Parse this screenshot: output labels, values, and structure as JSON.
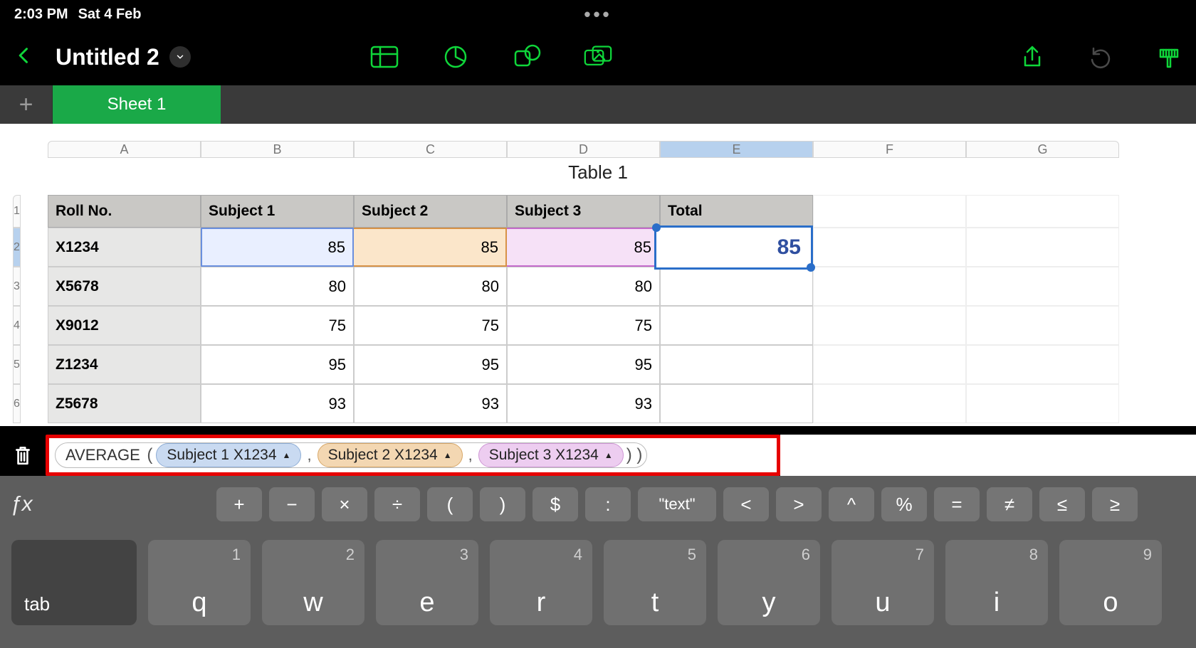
{
  "status": {
    "time": "2:03 PM",
    "date": "Sat 4 Feb"
  },
  "titlebar": {
    "doc_title": "Untitled 2"
  },
  "tabs": {
    "sheet": "Sheet 1"
  },
  "sheet": {
    "table_title": "Table 1",
    "columns": [
      "A",
      "B",
      "C",
      "D",
      "E",
      "F",
      "G"
    ],
    "selected_col": "E",
    "row_numbers": [
      "1",
      "2",
      "3",
      "4",
      "5",
      "6"
    ],
    "selected_row": "2",
    "headers": [
      "Roll No.",
      "Subject 1",
      "Subject 2",
      "Subject 3",
      "Total"
    ],
    "rows": [
      {
        "roll": "X1234",
        "s1": "85",
        "s2": "85",
        "s3": "85",
        "total": "85"
      },
      {
        "roll": "X5678",
        "s1": "80",
        "s2": "80",
        "s3": "80",
        "total": ""
      },
      {
        "roll": "X9012",
        "s1": "75",
        "s2": "75",
        "s3": "75",
        "total": ""
      },
      {
        "roll": "Z1234",
        "s1": "95",
        "s2": "95",
        "s3": "95",
        "total": ""
      },
      {
        "roll": "Z5678",
        "s1": "93",
        "s2": "93",
        "s3": "93",
        "total": ""
      }
    ],
    "active_value": "85"
  },
  "formula": {
    "function": "AVERAGE",
    "args": [
      {
        "label": "Subject 1 X1234",
        "cls": "arg-blue"
      },
      {
        "label": "Subject 2 X1234",
        "cls": "arg-orange"
      },
      {
        "label": "Subject 3 X1234",
        "cls": "arg-purple"
      }
    ]
  },
  "keyboard": {
    "fx": "ƒx",
    "ops": [
      "+",
      "−",
      "×",
      "÷",
      "(",
      ")",
      "$",
      ":",
      "\"text\"",
      "<",
      ">",
      "^",
      "%",
      "=",
      "≠",
      "≤",
      "≥"
    ],
    "tab": "tab",
    "letters": [
      {
        "n": "1",
        "l": "q"
      },
      {
        "n": "2",
        "l": "w"
      },
      {
        "n": "3",
        "l": "e"
      },
      {
        "n": "4",
        "l": "r"
      },
      {
        "n": "5",
        "l": "t"
      },
      {
        "n": "6",
        "l": "y"
      },
      {
        "n": "7",
        "l": "u"
      },
      {
        "n": "8",
        "l": "i"
      },
      {
        "n": "9",
        "l": "o"
      }
    ]
  }
}
